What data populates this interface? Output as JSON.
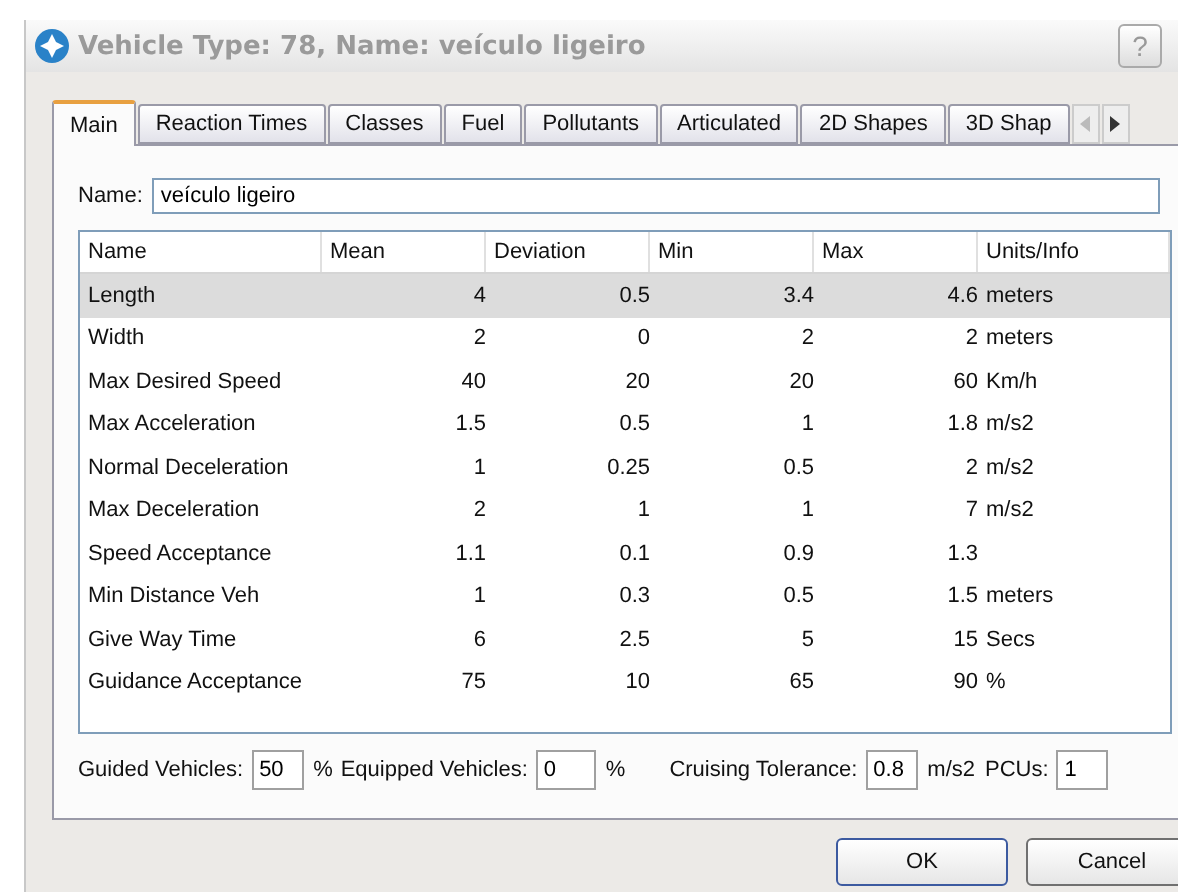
{
  "window": {
    "title": "Vehicle Type: 78, Name: veículo ligeiro",
    "help_button": "?"
  },
  "tabs": [
    {
      "label": "Main",
      "selected": true
    },
    {
      "label": "Reaction Times",
      "selected": false
    },
    {
      "label": "Classes",
      "selected": false
    },
    {
      "label": "Fuel",
      "selected": false
    },
    {
      "label": "Pollutants",
      "selected": false
    },
    {
      "label": "Articulated",
      "selected": false
    },
    {
      "label": "2D Shapes",
      "selected": false
    },
    {
      "label": "3D Shap",
      "selected": false
    }
  ],
  "name_field": {
    "label": "Name:",
    "value": "veículo ligeiro"
  },
  "table": {
    "columns": [
      "Name",
      "Mean",
      "Deviation",
      "Min",
      "Max",
      "Units/Info"
    ],
    "rows": [
      {
        "cells": [
          "Length",
          "4",
          "0.5",
          "3.4",
          "4.6",
          "meters"
        ],
        "selected": true
      },
      {
        "cells": [
          "Width",
          "2",
          "0",
          "2",
          "2",
          "meters"
        ],
        "selected": false
      },
      {
        "cells": [
          "Max Desired Speed",
          "40",
          "20",
          "20",
          "60",
          "Km/h"
        ],
        "selected": false
      },
      {
        "cells": [
          "Max Acceleration",
          "1.5",
          "0.5",
          "1",
          "1.8",
          "m/s2"
        ],
        "selected": false
      },
      {
        "cells": [
          "Normal Deceleration",
          "1",
          "0.25",
          "0.5",
          "2",
          "m/s2"
        ],
        "selected": false
      },
      {
        "cells": [
          "Max Deceleration",
          "2",
          "1",
          "1",
          "7",
          "m/s2"
        ],
        "selected": false
      },
      {
        "cells": [
          "Speed Acceptance",
          "1.1",
          "0.1",
          "0.9",
          "1.3",
          ""
        ],
        "selected": false
      },
      {
        "cells": [
          "Min Distance Veh",
          "1",
          "0.3",
          "0.5",
          "1.5",
          "meters"
        ],
        "selected": false
      },
      {
        "cells": [
          "Give Way Time",
          "6",
          "2.5",
          "5",
          "15",
          "Secs"
        ],
        "selected": false
      },
      {
        "cells": [
          "Guidance Acceptance",
          "75",
          "10",
          "65",
          "90",
          "%"
        ],
        "selected": false
      }
    ]
  },
  "footer_fields": [
    {
      "label": "Guided Vehicles:",
      "value": "50",
      "unit": "%"
    },
    {
      "label": "Equipped Vehicles:",
      "value": "0",
      "unit": "%"
    },
    {
      "label": "Cruising Tolerance:",
      "value": "0.8",
      "unit": "m/s2"
    },
    {
      "label": "PCUs:",
      "value": "1"
    }
  ],
  "buttons": [
    "OK",
    "Cancel"
  ]
}
